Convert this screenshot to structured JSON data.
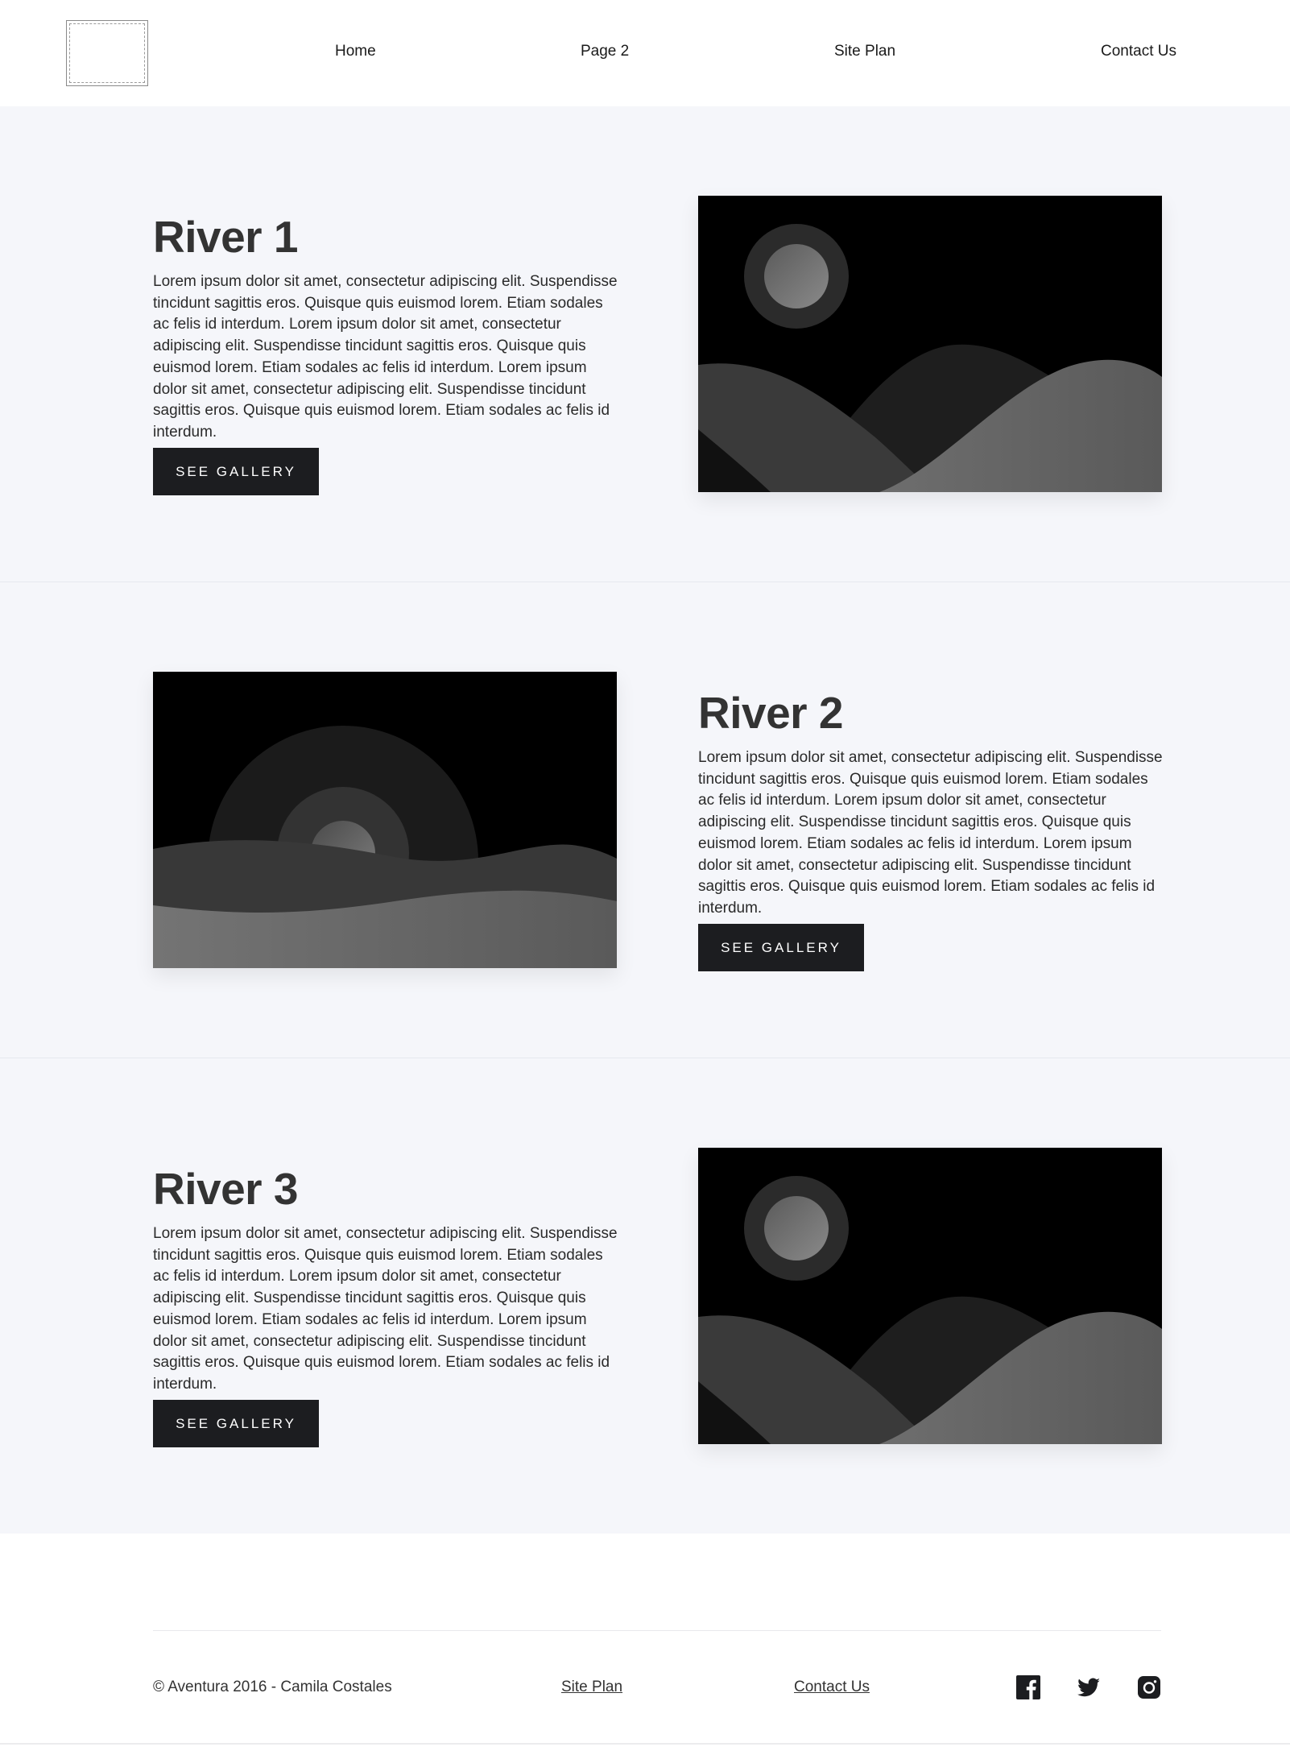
{
  "nav": {
    "home": "Home",
    "page2": "Page 2",
    "site_plan": "Site Plan",
    "contact": "Contact Us"
  },
  "sections": [
    {
      "title": "River 1",
      "body": "Lorem ipsum dolor sit amet, consectetur adipiscing elit. Suspendisse tincidunt sagittis eros. Quisque quis euismod lorem. Etiam sodales ac felis id interdum. Lorem ipsum dolor sit amet, consectetur adipiscing elit. Suspendisse tincidunt sagittis eros. Quisque quis euismod lorem. Etiam sodales ac felis id interdum. Lorem ipsum dolor sit amet, consectetur adipiscing elit. Suspendisse tincidunt sagittis eros. Quisque quis euismod lorem. Etiam sodales ac felis id interdum.",
      "button": "SEE GALLERY"
    },
    {
      "title": "River 2",
      "body": "Lorem ipsum dolor sit amet, consectetur adipiscing elit. Suspendisse tincidunt sagittis eros. Quisque quis euismod lorem. Etiam sodales ac felis id interdum. Lorem ipsum dolor sit amet, consectetur adipiscing elit. Suspendisse tincidunt sagittis eros. Quisque quis euismod lorem. Etiam sodales ac felis id interdum. Lorem ipsum dolor sit amet, consectetur adipiscing elit. Suspendisse tincidunt sagittis eros. Quisque quis euismod lorem. Etiam sodales ac felis id interdum.",
      "button": "SEE GALLERY"
    },
    {
      "title": "River 3",
      "body": "Lorem ipsum dolor sit amet, consectetur adipiscing elit. Suspendisse tincidunt sagittis eros. Quisque quis euismod lorem. Etiam sodales ac felis id interdum. Lorem ipsum dolor sit amet, consectetur adipiscing elit. Suspendisse tincidunt sagittis eros. Quisque quis euismod lorem. Etiam sodales ac felis id interdum. Lorem ipsum dolor sit amet, consectetur adipiscing elit. Suspendisse tincidunt sagittis eros. Quisque quis euismod lorem. Etiam sodales ac felis id interdum.",
      "button": "SEE GALLERY"
    }
  ],
  "footer": {
    "copyright": "© Aventura 2016 - Camila Costales",
    "site_plan": "Site Plan",
    "contact": "Contact Us",
    "social_icons": [
      "facebook-icon",
      "twitter-icon",
      "instagram-icon"
    ]
  },
  "colors": {
    "section_bg": "#f5f6fa",
    "button_bg": "#1c1d20",
    "title": "#333333"
  }
}
